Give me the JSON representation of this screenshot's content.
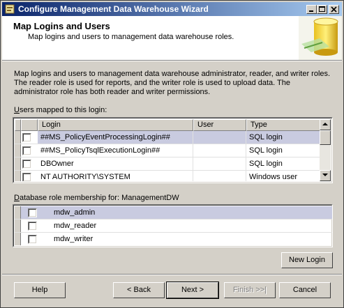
{
  "window": {
    "title": "Configure Management Data Warehouse Wizard"
  },
  "header": {
    "title": "Map Logins and Users",
    "subtitle": "Map logins and users to management data warehouse roles."
  },
  "description": "Map logins and users to management data warehouse administrator, reader, and writer roles. The reader role is used for reports, and the writer role is used to upload data. The administrator role has both reader and writer permissions.",
  "users_section": {
    "label_accel": "U",
    "label_rest": "sers mapped to this login:",
    "columns": [
      "Login",
      "User",
      "Type"
    ],
    "rows": [
      {
        "login": "##MS_PolicyEventProcessingLogin##",
        "user": "",
        "type": "SQL login",
        "checked": false,
        "selected": true
      },
      {
        "login": "##MS_PolicyTsqlExecutionLogin##",
        "user": "",
        "type": "SQL login",
        "checked": false,
        "selected": false
      },
      {
        "login": "DBOwner",
        "user": "",
        "type": "SQL login",
        "checked": false,
        "selected": false
      },
      {
        "login": "NT AUTHORITY\\SYSTEM",
        "user": "",
        "type": "Windows user",
        "checked": false,
        "selected": false
      }
    ]
  },
  "roles_section": {
    "label_accel": "D",
    "label_rest": "atabase role membership for: ManagementDW",
    "rows": [
      {
        "role": "mdw_admin",
        "checked": false,
        "selected": true
      },
      {
        "role": "mdw_reader",
        "checked": false,
        "selected": false
      },
      {
        "role": "mdw_writer",
        "checked": false,
        "selected": false
      }
    ]
  },
  "buttons": {
    "new_login": "New Login",
    "help": "Help",
    "back": "< Back",
    "next": "Next >",
    "finish": "Finish >>|",
    "cancel": "Cancel"
  },
  "colors": {
    "title_gradient_start": "#0a246a",
    "title_gradient_end": "#a6caf0",
    "selection": "#c9cbe0"
  }
}
